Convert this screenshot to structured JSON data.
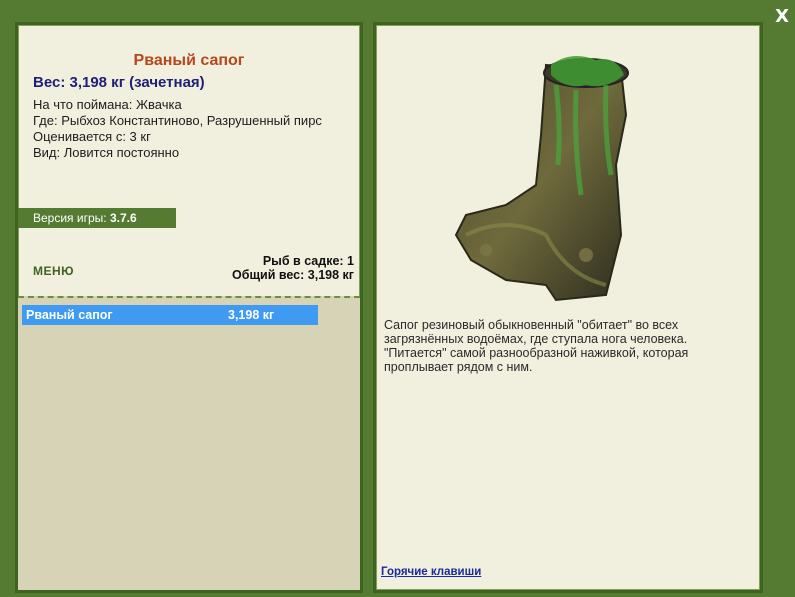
{
  "close_label": "X",
  "fish": {
    "title": "Рваный сапог",
    "weight": "Вес: 3,198 кг (зачетная)",
    "info": [
      "На что поймана: Жвачка",
      "Где: Рыбхоз Константиново, Разрушенный пирс",
      "Оценивается с: 3 кг",
      "Вид: Ловится постоянно"
    ]
  },
  "version": {
    "label": "Версия игры:",
    "value": "3.7.6"
  },
  "menu_label": "МЕНЮ",
  "stats": {
    "count": "Рыб в садке: 1",
    "total": "Общий вес: 3,198 кг"
  },
  "catch_list": [
    {
      "name": "Рваный сапог",
      "weight": "3,198 кг"
    }
  ],
  "description": "Сапог резиновый обыкновенный \"обитает\" во всех загрязнённых водоёмах, где ступала нога человека. \"Питается\" самой разнообразной наживкой, которая проплывает рядом с ним.",
  "hotkeys_label": "Горячие клавиши",
  "image_icon": "torn-boot-image"
}
